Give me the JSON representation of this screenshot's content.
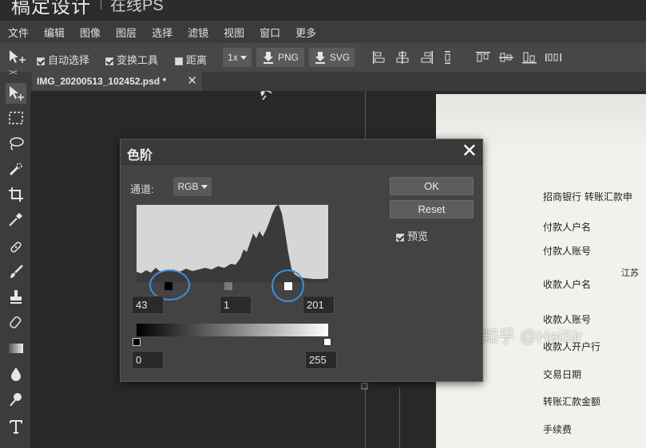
{
  "app": {
    "brand": "稿定设计",
    "subtitle": "在线PS"
  },
  "menu": [
    "文件",
    "编辑",
    "图像",
    "图层",
    "选择",
    "滤镜",
    "视图",
    "窗口",
    "更多"
  ],
  "options": {
    "auto_select_label": "自动选择",
    "auto_select_checked": true,
    "transform_label": "变换工具",
    "transform_checked": true,
    "distance_label": "距离",
    "distance_checked": false,
    "zoom_value": "1x",
    "png_label": "PNG",
    "svg_label": "SVG"
  },
  "document_tab": {
    "name": "IMG_20200513_102452.psd *",
    "close": "✕"
  },
  "tools": [
    "move-tool",
    "marquee-tool",
    "lasso-tool",
    "quick-select-tool",
    "crop-tool",
    "eyedropper-tool",
    "healing-brush-tool",
    "brush-tool",
    "clone-stamp-tool",
    "eraser-tool",
    "gradient-tool",
    "blur-tool",
    "dodge-tool",
    "type-tool"
  ],
  "dialog": {
    "title": "色阶",
    "close": "✕",
    "channel_label": "通道:",
    "channel_value": "RGB",
    "ok_label": "OK",
    "reset_label": "Reset",
    "preview_label": "预览",
    "preview_checked": true,
    "input_black": "43",
    "input_gamma": "1",
    "input_white": "201",
    "output_black": "0",
    "output_white": "255",
    "histogram_fill": "#d6d6d6",
    "histogram_ink": "#3a3a3a",
    "highlight_ring_color": "#3d8fe0"
  },
  "document": {
    "lines": [
      "招商银行  转账汇款申",
      "付款人户名",
      "付款人账号",
      "收款人户名",
      "江苏",
      "收款人账号",
      "收款人开户行",
      "交易日期",
      "转账汇款金额",
      "手续费"
    ]
  },
  "watermark": "知乎 @HeiSir"
}
